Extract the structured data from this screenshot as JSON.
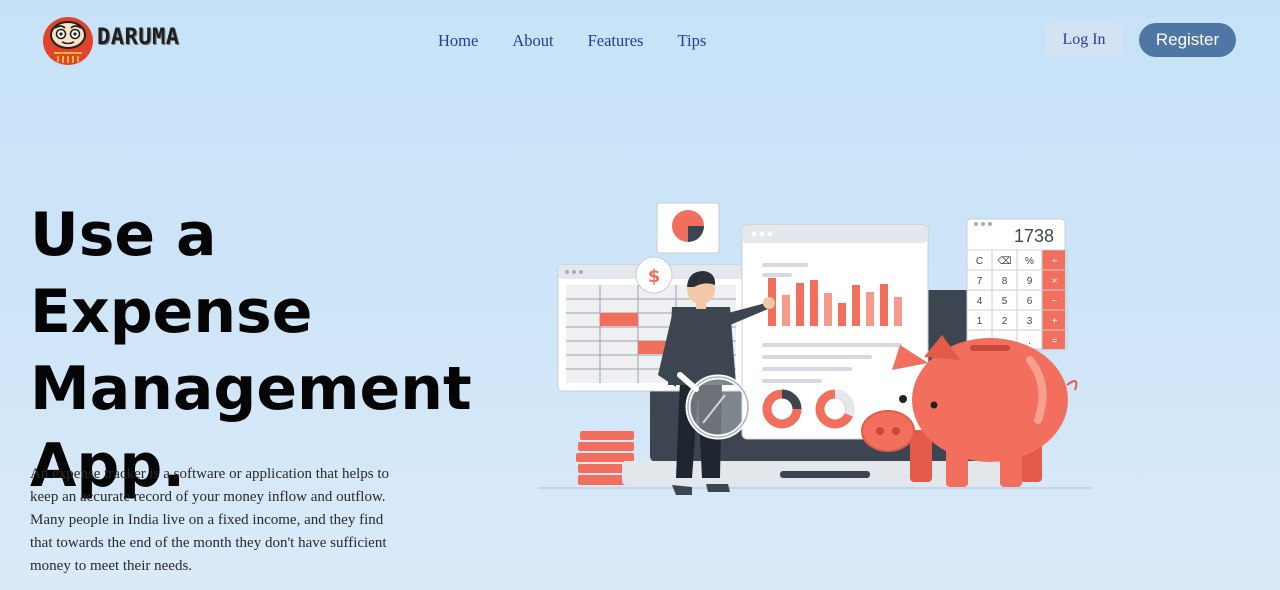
{
  "brand": {
    "name": "DARUMA",
    "logo_icon": "daruma-doll-icon"
  },
  "nav": {
    "items": [
      {
        "label": "Home"
      },
      {
        "label": "About"
      },
      {
        "label": "Features"
      },
      {
        "label": "Tips"
      }
    ]
  },
  "auth": {
    "login_label": "Log In",
    "register_label": "Register"
  },
  "hero": {
    "title": "Use a Expense Management App.",
    "description": "An expense tracker is a software or application that helps to keep an accurate record of your money inflow and outflow. Many people in India live on a fixed income, and they find that towards the end of the month they don't have sufficient money to meet their needs."
  },
  "illustration": {
    "calculator_display": "1738",
    "calculator_keys": [
      "C",
      "⌫",
      "%",
      "÷",
      "7",
      "8",
      "9",
      "×",
      "4",
      "5",
      "6",
      "−",
      "1",
      "2",
      "3",
      "+",
      "",
      "",
      ".",
      "="
    ],
    "dollar_symbol": "$",
    "colors": {
      "accent": "#f36f5d",
      "dark": "#3d4650",
      "brand_button": "#4f76a5",
      "nav_link": "#2a3b9c"
    }
  }
}
